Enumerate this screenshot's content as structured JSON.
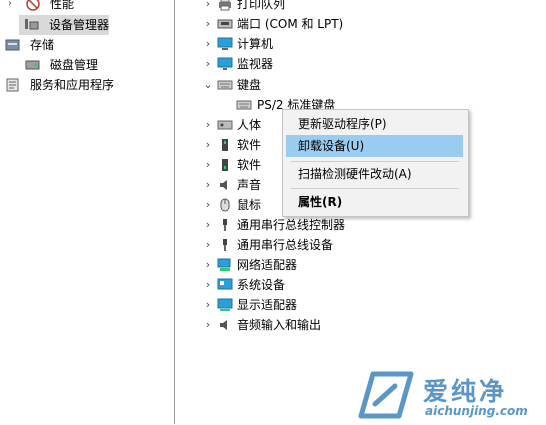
{
  "left_pane": {
    "items": [
      {
        "label": "性能",
        "icon": "performance-icon"
      },
      {
        "label": "设备管理器",
        "icon": "device-manager-icon",
        "selected": true
      },
      {
        "label": "存储",
        "icon": "storage-icon"
      },
      {
        "label": "磁盘管理",
        "icon": "disk-management-icon"
      },
      {
        "label": "服务和应用程序",
        "icon": "services-icon"
      }
    ]
  },
  "device_tree": {
    "categories": [
      {
        "label": "打印队列",
        "icon": "printer-icon"
      },
      {
        "label": "端口 (COM 和 LPT)",
        "icon": "port-icon"
      },
      {
        "label": "计算机",
        "icon": "computer-icon"
      },
      {
        "label": "监视器",
        "icon": "monitor-icon"
      },
      {
        "label": "键盘",
        "icon": "keyboard-icon",
        "expanded": true
      },
      {
        "label": "PS/2 标准键盘",
        "icon": "keyboard-icon",
        "child": true
      },
      {
        "label": "人体",
        "icon": "hid-icon"
      },
      {
        "label": "软件",
        "icon": "software-icon"
      },
      {
        "label": "软件",
        "icon": "software-device-icon"
      },
      {
        "label": "声音",
        "icon": "sound-icon"
      },
      {
        "label": "鼠标",
        "icon": "mouse-icon"
      },
      {
        "label": "通用串行总线控制器",
        "icon": "usb-icon"
      },
      {
        "label": "通用串行总线设备",
        "icon": "usb-icon"
      },
      {
        "label": "网络适配器",
        "icon": "network-icon"
      },
      {
        "label": "系统设备",
        "icon": "system-icon"
      },
      {
        "label": "显示适配器",
        "icon": "display-adapter-icon"
      },
      {
        "label": "音频输入和输出",
        "icon": "audio-io-icon"
      }
    ]
  },
  "context_menu": {
    "update_driver": "更新驱动程序(P)",
    "uninstall_device": "卸载设备(U)",
    "scan_hardware": "扫描检测硬件改动(A)",
    "properties": "属性(R)"
  },
  "watermark": {
    "brand": "爱纯净",
    "url": "aichunjing.com"
  },
  "colors": {
    "menu_highlight": "#99ccf0",
    "selection": "#d9d9d9",
    "watermark": "#5a96c8"
  }
}
